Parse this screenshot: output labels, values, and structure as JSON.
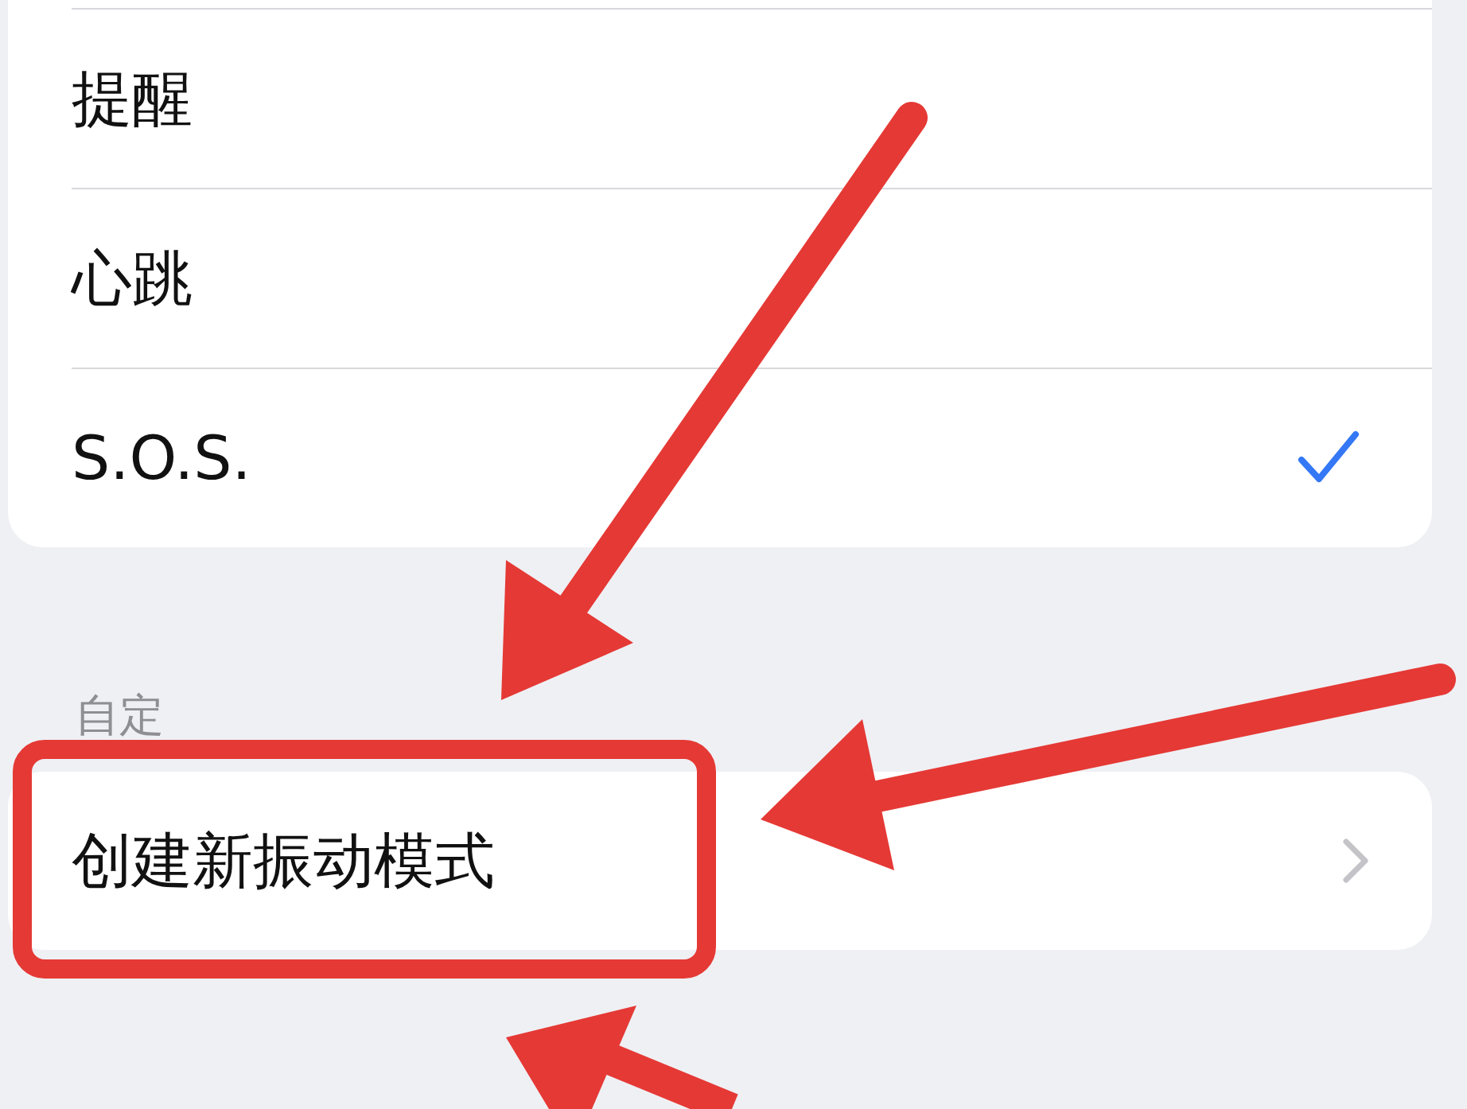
{
  "options": [
    {
      "label": "提醒",
      "selected": false
    },
    {
      "label": "心跳",
      "selected": false
    },
    {
      "label": "S.O.S.",
      "selected": true
    }
  ],
  "custom_section": {
    "header": "自定",
    "items": [
      {
        "label": "创建新振动模式"
      }
    ]
  }
}
